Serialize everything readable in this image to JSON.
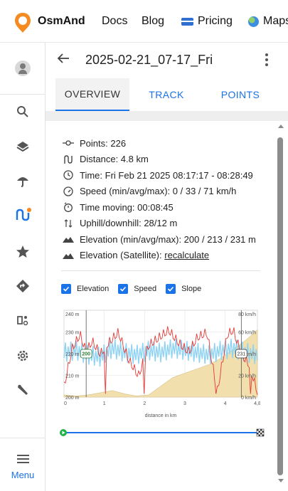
{
  "topbar": {
    "brand": "OsmAnd",
    "nav": {
      "docs": "Docs",
      "blog": "Blog",
      "pricing": "Pricing",
      "maps": "Maps"
    },
    "brand_color": "#f58a20"
  },
  "sidebar": {
    "items": [
      "account",
      "search",
      "layers",
      "weather",
      "tracks",
      "favorites",
      "navigation",
      "plugins",
      "settings",
      "tools"
    ],
    "active": "tracks",
    "menu_label": "Menu",
    "accent": "#1a73e8",
    "active_dot": "#f58a20"
  },
  "header": {
    "title": "2025-02-21_07-17_Fri"
  },
  "tabs": [
    {
      "label": "OVERVIEW",
      "active": true
    },
    {
      "label": "TRACK",
      "active": false
    },
    {
      "label": "POINTS",
      "active": false
    }
  ],
  "info": {
    "points": "Points: 226",
    "distance": "Distance: 4.8 km",
    "time": "Time: Fri Feb 21 2025 08:17:17 - 08:28:49",
    "speed": "Speed (min/avg/max): 0 / 33 / 71 km/h",
    "time_moving": "Time moving: 00:08:45",
    "uphill": "Uphill/downhill: 28/12 m",
    "elevation": "Elevation (min/avg/max): 200 / 213 / 231 m",
    "elevation_sat_prefix": "Elevation (Satellite): ",
    "elevation_sat_link": "recalculate"
  },
  "checkboxes": [
    {
      "label": "Elevation",
      "checked": true
    },
    {
      "label": "Speed",
      "checked": true
    },
    {
      "label": "Slope",
      "checked": true
    }
  ],
  "chart_data": {
    "type": "area",
    "xlabel": "distance in km",
    "x_ticks": [
      "0",
      "1",
      "2",
      "3",
      "4",
      "4,8"
    ],
    "xlim": [
      0,
      4.8
    ],
    "y_left_ticks": [
      "240 m",
      "230 m",
      "220 m",
      "210 m",
      "200 m"
    ],
    "y_left_range": [
      200,
      240
    ],
    "y_right_ticks": [
      "80 km/h",
      "60 km/h",
      "40 km/h",
      "20 km/h",
      "0 km/h"
    ],
    "y_right_range": [
      0,
      80
    ],
    "markers": {
      "left": "200",
      "right": "231"
    },
    "series": [
      {
        "name": "Elevation",
        "color": "#f2dfae",
        "x": [
          0,
          0.3,
          0.6,
          0.9,
          1.2,
          1.5,
          1.8,
          2.1,
          2.4,
          2.7,
          3.0,
          3.3,
          3.6,
          3.9,
          4.2,
          4.5,
          4.8
        ],
        "values": [
          201,
          200.5,
          201,
          202,
          203,
          201.5,
          200.5,
          201,
          205,
          209,
          211,
          213,
          215,
          218,
          222,
          226,
          231
        ]
      },
      {
        "name": "Speed",
        "color": "#e53935",
        "x": [
          0,
          0.2,
          0.4,
          0.55,
          0.7,
          0.9,
          1.1,
          1.35,
          1.6,
          1.85,
          2.1,
          2.35,
          2.6,
          2.85,
          3.1,
          3.3,
          3.55,
          3.8,
          4.05,
          4.2,
          4.4,
          4.6,
          4.8
        ],
        "values": [
          10,
          45,
          58,
          42,
          52,
          40,
          50,
          60,
          35,
          20,
          48,
          55,
          62,
          50,
          42,
          55,
          60,
          5,
          58,
          62,
          40,
          30,
          5
        ]
      },
      {
        "name": "Slope",
        "color": "#8fd3f4",
        "x": [
          0,
          0.3,
          0.6,
          0.9,
          1.2,
          1.5,
          1.8,
          2.1,
          2.4,
          2.7,
          3.0,
          3.3,
          3.6,
          3.9,
          4.2,
          4.5,
          4.8
        ],
        "values": [
          220,
          221,
          219,
          218,
          222,
          220,
          219,
          221,
          220,
          222,
          221,
          220,
          219,
          221,
          222,
          220,
          219
        ]
      }
    ]
  }
}
